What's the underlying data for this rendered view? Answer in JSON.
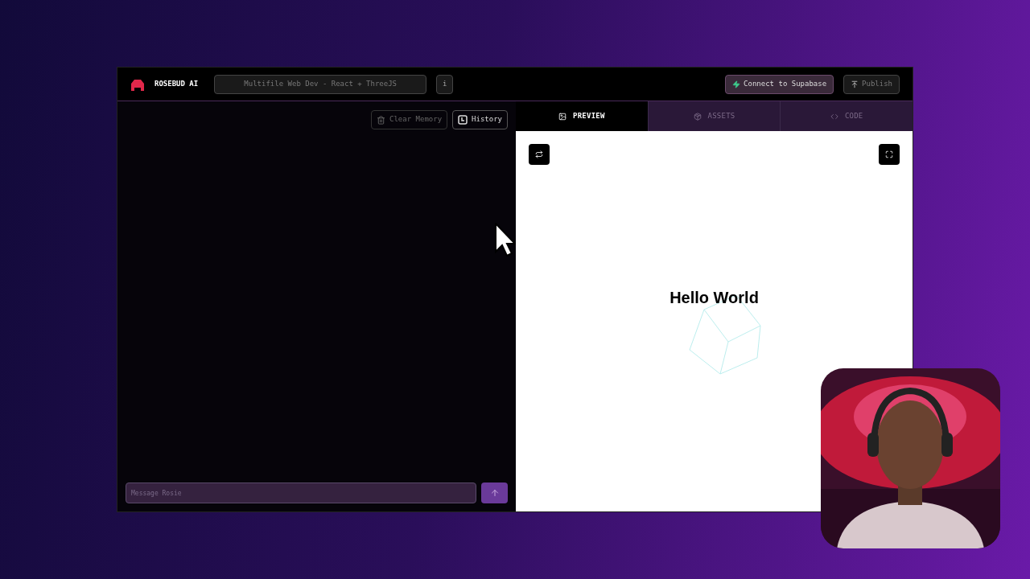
{
  "header": {
    "brand": "ROSEBUD AI",
    "project_title": "Multifile Web Dev - React + ThreeJS",
    "info_button": "i",
    "actions": [
      {
        "kind": "supabase",
        "label": "Connect to Supabase"
      },
      {
        "kind": "publish",
        "label": "Publish",
        "disabled": true
      }
    ]
  },
  "chat": {
    "toolbar": [
      {
        "kind": "clear",
        "label": "Clear Memory",
        "disabled": true
      },
      {
        "kind": "history",
        "label": "History",
        "disabled": false
      }
    ],
    "message": {
      "placeholder": "Message Rosie"
    }
  },
  "tabs": [
    {
      "kind": "preview",
      "label": "PREVIEW",
      "selected": true
    },
    {
      "kind": "assets",
      "label": "ASSETS",
      "selected": false
    },
    {
      "kind": "code",
      "label": "CODE",
      "selected": false
    }
  ],
  "preview": {
    "heading": "Hello World"
  }
}
